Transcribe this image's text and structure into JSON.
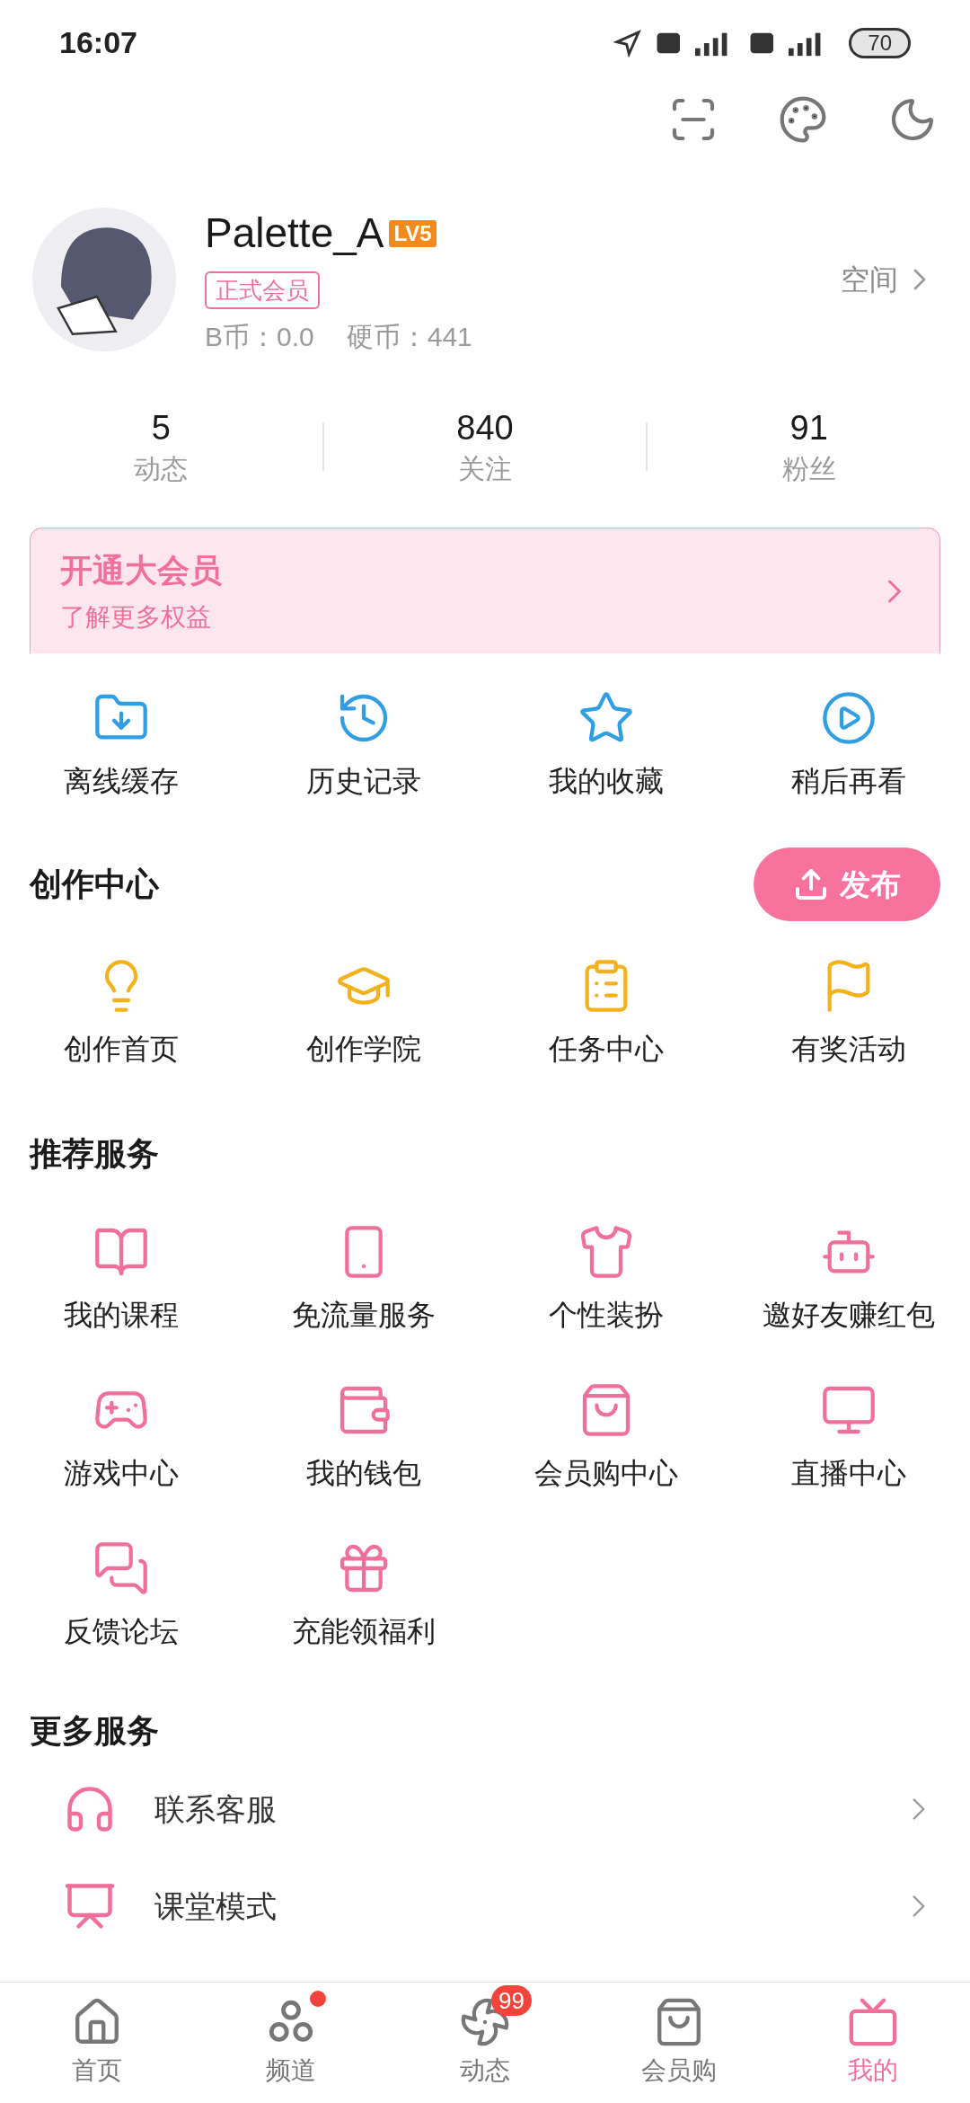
{
  "status_bar": {
    "time": "16:07",
    "battery": "70"
  },
  "profile": {
    "name": "Palette_A",
    "level": "LV5",
    "member_badge": "正式会员",
    "b_coin": "B币：0.0",
    "coins": "硬币：441",
    "space_link": "空间"
  },
  "stats": [
    {
      "value": "5",
      "label": "动态"
    },
    {
      "value": "840",
      "label": "关注"
    },
    {
      "value": "91",
      "label": "粉丝"
    }
  ],
  "vip_banner": {
    "title": "开通大会员",
    "subtitle": "了解更多权益"
  },
  "quick_actions": [
    {
      "label": "离线缓存"
    },
    {
      "label": "历史记录"
    },
    {
      "label": "我的收藏"
    },
    {
      "label": "稍后再看"
    }
  ],
  "creation_center": {
    "title": "创作中心",
    "publish_button": "发布",
    "items": [
      {
        "label": "创作首页"
      },
      {
        "label": "创作学院"
      },
      {
        "label": "任务中心"
      },
      {
        "label": "有奖活动"
      }
    ]
  },
  "recommended_services": {
    "title": "推荐服务",
    "items": [
      {
        "label": "我的课程"
      },
      {
        "label": "免流量服务"
      },
      {
        "label": "个性装扮"
      },
      {
        "label": "邀好友赚红包"
      },
      {
        "label": "游戏中心"
      },
      {
        "label": "我的钱包"
      },
      {
        "label": "会员购中心"
      },
      {
        "label": "直播中心"
      },
      {
        "label": "反馈论坛"
      },
      {
        "label": "充能领福利"
      }
    ]
  },
  "more_services": {
    "title": "更多服务",
    "rows": [
      {
        "label": "联系客服"
      },
      {
        "label": "课堂模式"
      }
    ]
  },
  "bottom_nav": [
    {
      "label": "首页",
      "selected": false,
      "dot": false
    },
    {
      "label": "频道",
      "selected": false,
      "dot": true
    },
    {
      "label": "动态",
      "selected": false,
      "dot": false,
      "badge": "99"
    },
    {
      "label": "会员购",
      "selected": false,
      "dot": false
    },
    {
      "label": "我的",
      "selected": true,
      "dot": false
    }
  ]
}
